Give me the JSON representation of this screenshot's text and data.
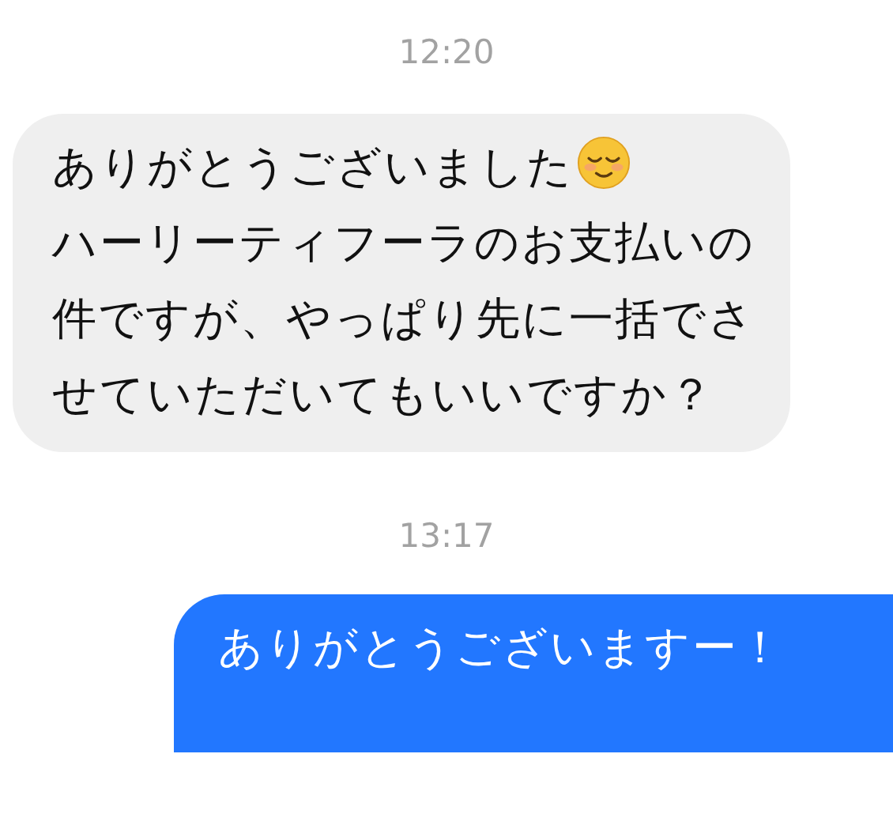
{
  "messages": [
    {
      "kind": "time",
      "text": "12:20"
    },
    {
      "kind": "received",
      "segments": [
        {
          "kind": "text",
          "text": "ありがとうございました"
        },
        {
          "kind": "emoji"
        },
        {
          "kind": "text",
          "text": "ハーリーティフーラのお支払いの件ですが、やっぱり先に一括でさせていただいてもいいですか？"
        }
      ]
    },
    {
      "kind": "time",
      "text": "13:17"
    },
    {
      "kind": "sent",
      "segments": [
        {
          "kind": "text",
          "text": "ありがとうございますー！"
        }
      ]
    }
  ]
}
